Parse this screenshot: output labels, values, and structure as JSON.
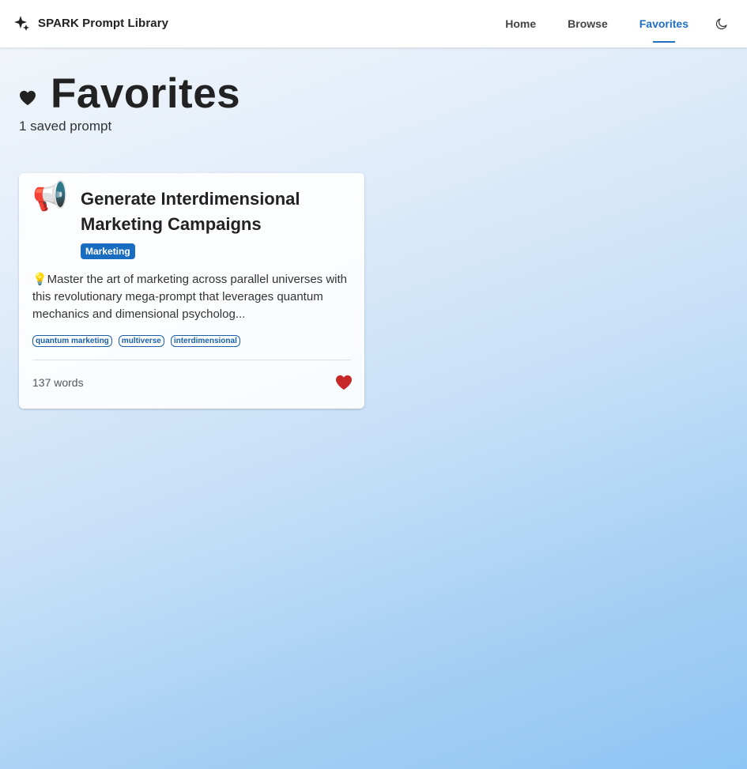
{
  "app": {
    "title": "SPARK Prompt Library",
    "brand_icon": "sparkles-icon"
  },
  "nav": {
    "items": [
      {
        "label": "Home",
        "active": false
      },
      {
        "label": "Browse",
        "active": false
      },
      {
        "label": "Favorites",
        "active": true
      }
    ],
    "theme_toggle_icon": "moon-icon"
  },
  "page": {
    "title": "Favorites",
    "title_icon": "heart-icon",
    "subtitle": "1 saved prompt"
  },
  "cards": [
    {
      "emoji": "📢",
      "title": "Generate Interdimensional Marketing Campaigns",
      "category": "Marketing",
      "description": "💡Master the art of marketing across parallel universes with this revolutionary mega-prompt that leverages quantum mechanics and dimensional psycholog...",
      "tags": [
        "quantum marketing",
        "multiverse",
        "interdimensional"
      ],
      "word_count": "137 words",
      "favorite_icon": "heart-icon",
      "favorited": true
    }
  ],
  "colors": {
    "accent": "#1e6fc2",
    "badge": "#1a6cc0",
    "favorite": "#c62828"
  }
}
